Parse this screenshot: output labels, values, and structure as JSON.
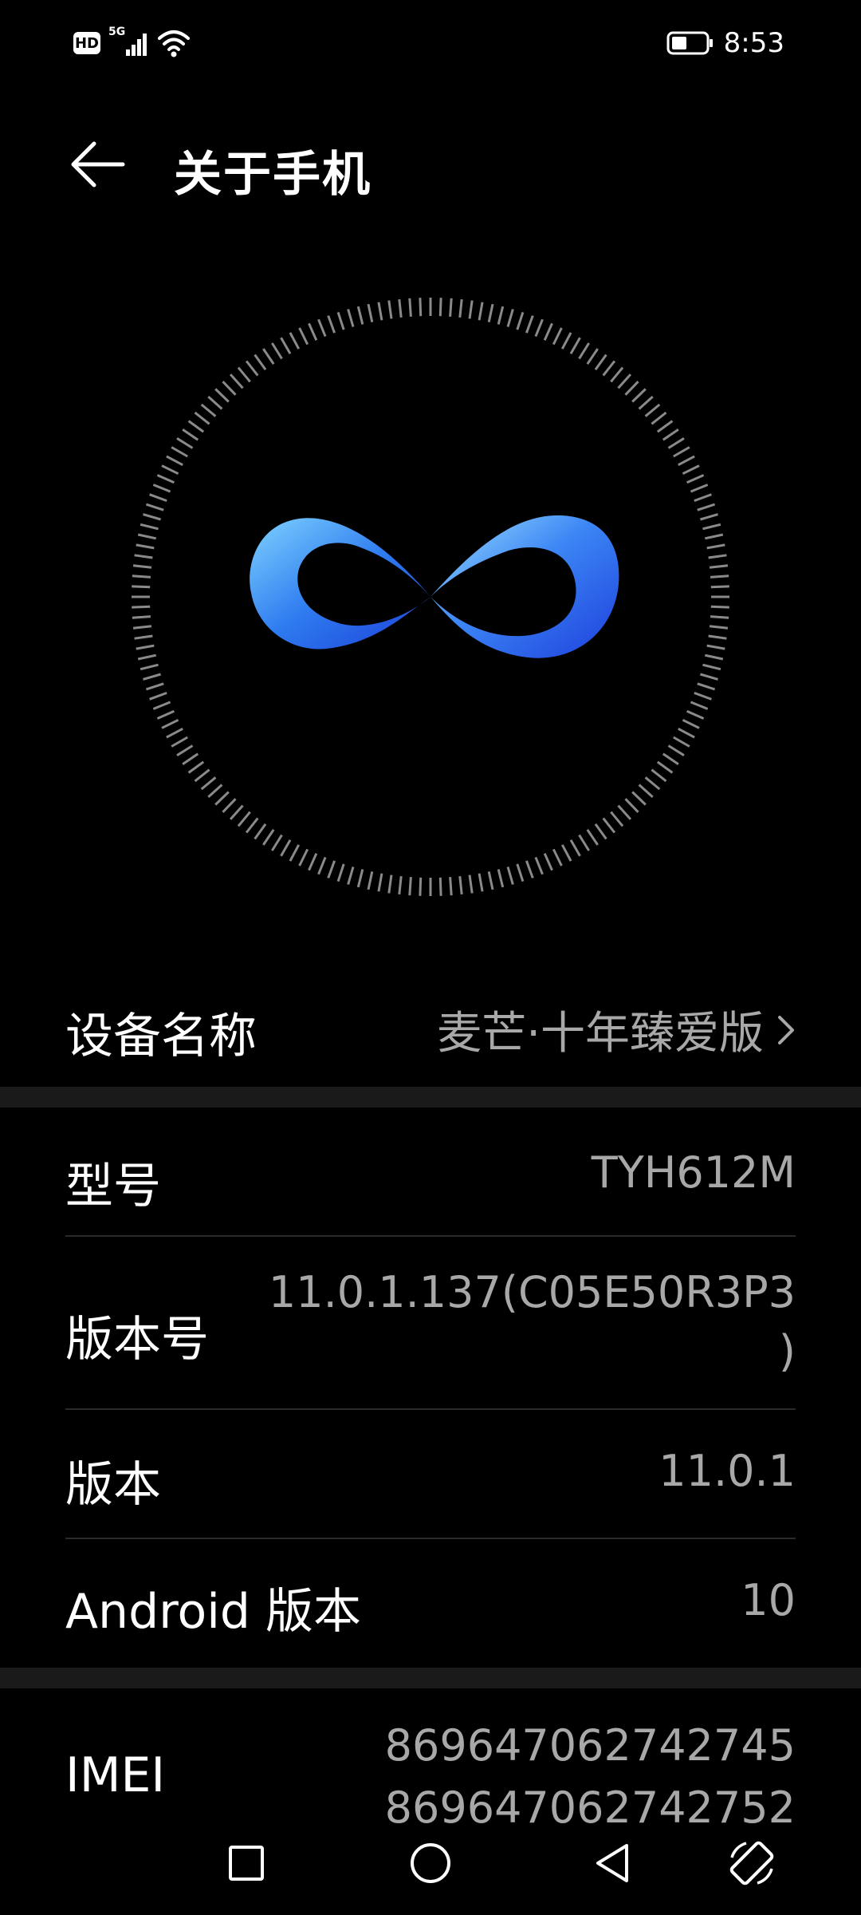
{
  "status_bar": {
    "hd_badge": "HD",
    "network": "5G",
    "time": "8:53"
  },
  "header": {
    "title": "关于手机"
  },
  "device_name": {
    "label": "设备名称",
    "value": "麦芒·十年臻爱版"
  },
  "info": {
    "model": {
      "label": "型号",
      "value": "TYH612M"
    },
    "build_number": {
      "label": "版本号",
      "value_line1": "11.0.1.137(C05E50R3P3",
      "value_line2": ")"
    },
    "version": {
      "label": "版本",
      "value": "11.0.1"
    },
    "android_version": {
      "label": "Android 版本",
      "value": "10"
    },
    "imei": {
      "label": "IMEI",
      "value_line1": "869647062742745",
      "value_line2": "869647062742752"
    }
  },
  "colors": {
    "background": "#000000",
    "secondary_text": "#a8a8a8",
    "section_gap": "#1a1a1a",
    "logo_light": "#6ec8ff",
    "logo_dark": "#1f4fe0"
  },
  "nav_bar": {
    "icons": [
      "square-icon",
      "circle-icon",
      "triangle-back-icon",
      "rotate-screen-icon"
    ]
  }
}
